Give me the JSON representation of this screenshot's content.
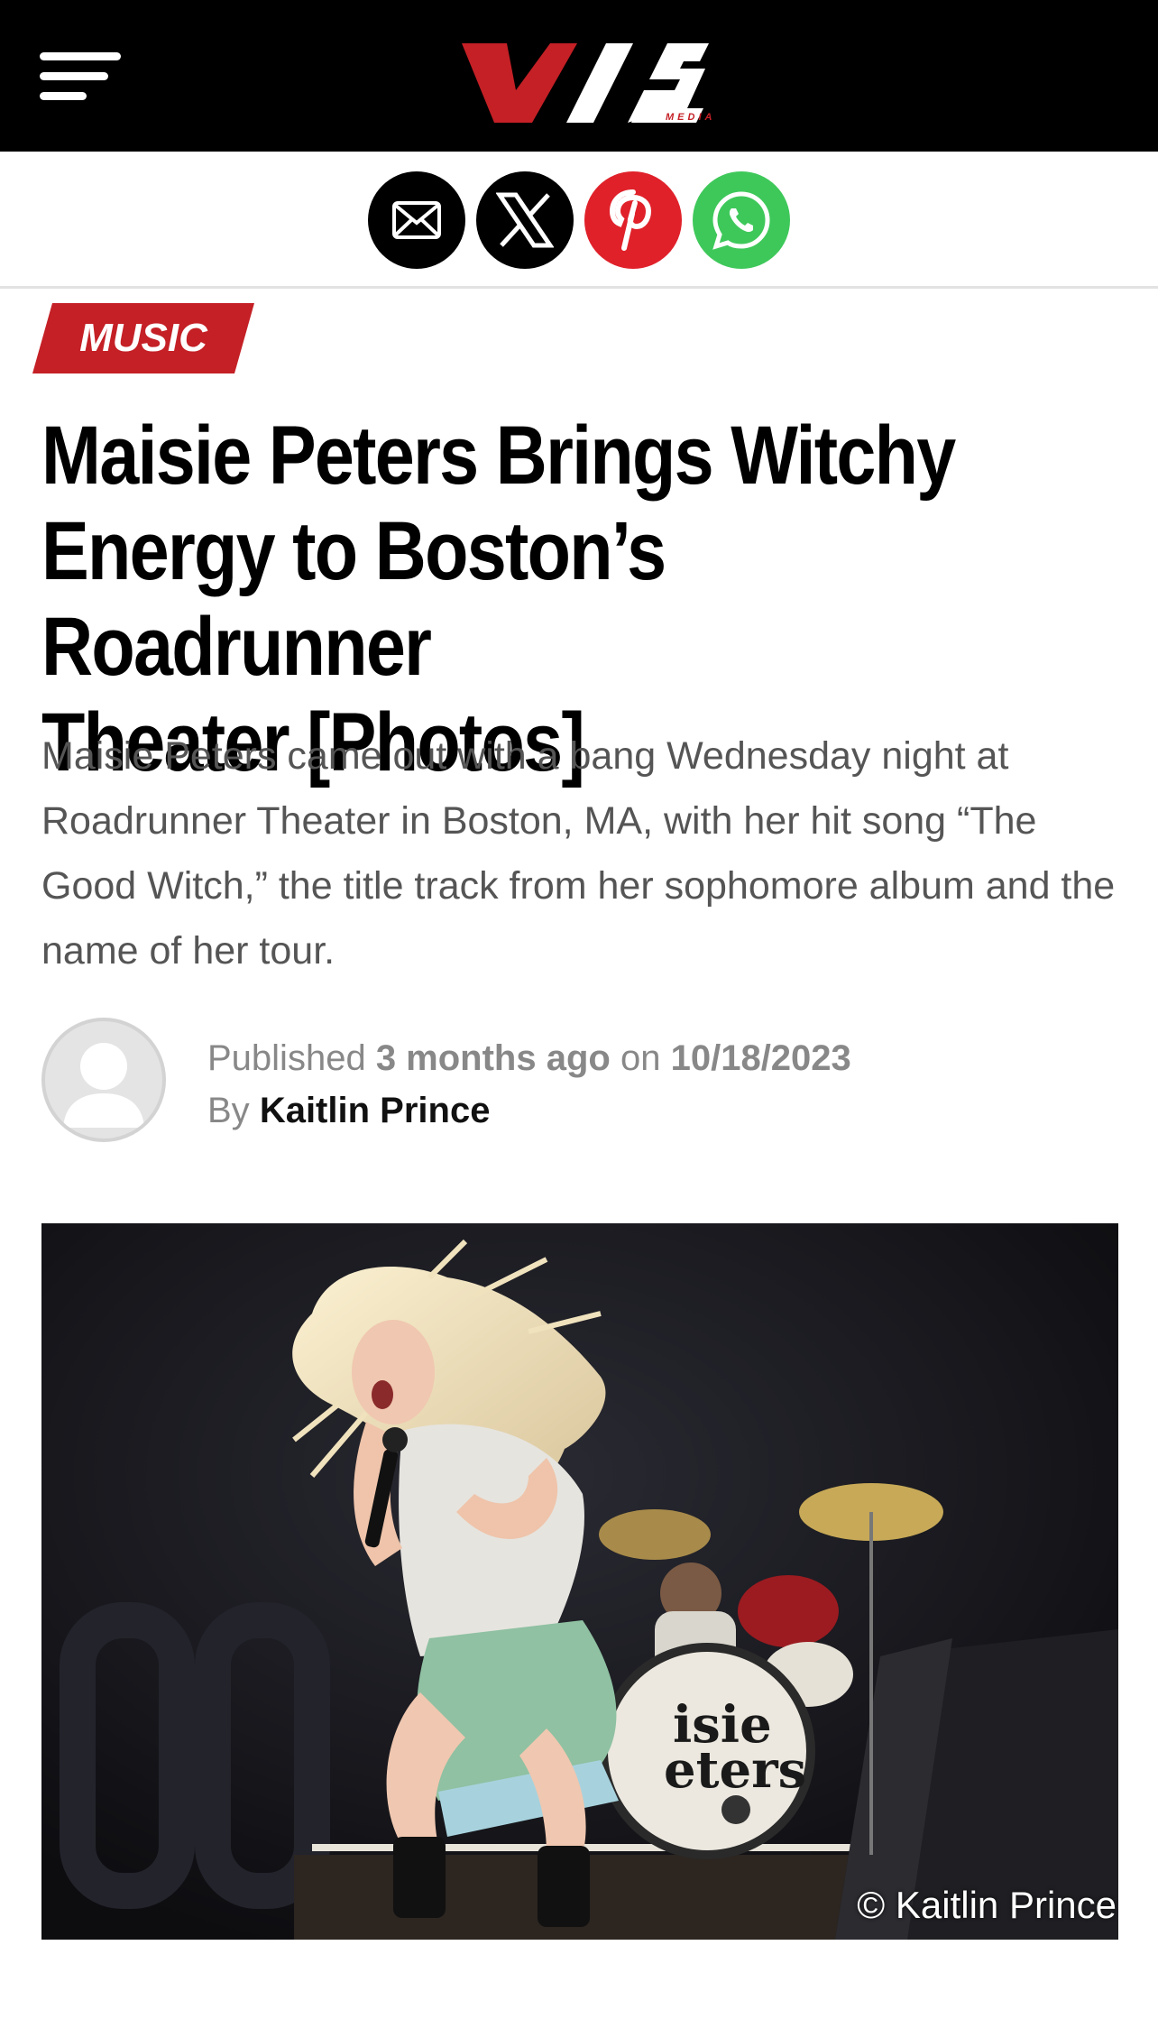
{
  "header": {
    "menu_icon": "hamburger-icon",
    "logo_text": "VIS",
    "logo_sub": "MEDIA"
  },
  "share": {
    "buttons": [
      {
        "icon": "email-icon",
        "color": "#000000"
      },
      {
        "icon": "x-icon",
        "color": "#000000"
      },
      {
        "icon": "pinterest-icon",
        "color": "#e0212a"
      },
      {
        "icon": "whatsapp-icon",
        "color": "#3ec85a"
      }
    ]
  },
  "article": {
    "category": "MUSIC",
    "category_color": "#c42026",
    "title_lines": [
      "Maisie Peters Brings Witchy",
      "Energy to Boston’s Roadrunner",
      "Theater [Photos]"
    ],
    "excerpt": "Maisie Peters came out with a bang Wednesday night at Roadrunner Theater in Boston, MA, with her hit song “The Good Witch,” the title track from her sophomore album and the name of her tour.",
    "meta": {
      "published_label": "Published",
      "relative_time": "3 months ago",
      "on_label": "on",
      "date": "10/18/2023",
      "by_label": "By",
      "author": "Kaitlin Prince"
    },
    "image": {
      "credit": "© Kaitlin Prince",
      "drum_text_1": "isie",
      "drum_text_2": "eters"
    }
  }
}
